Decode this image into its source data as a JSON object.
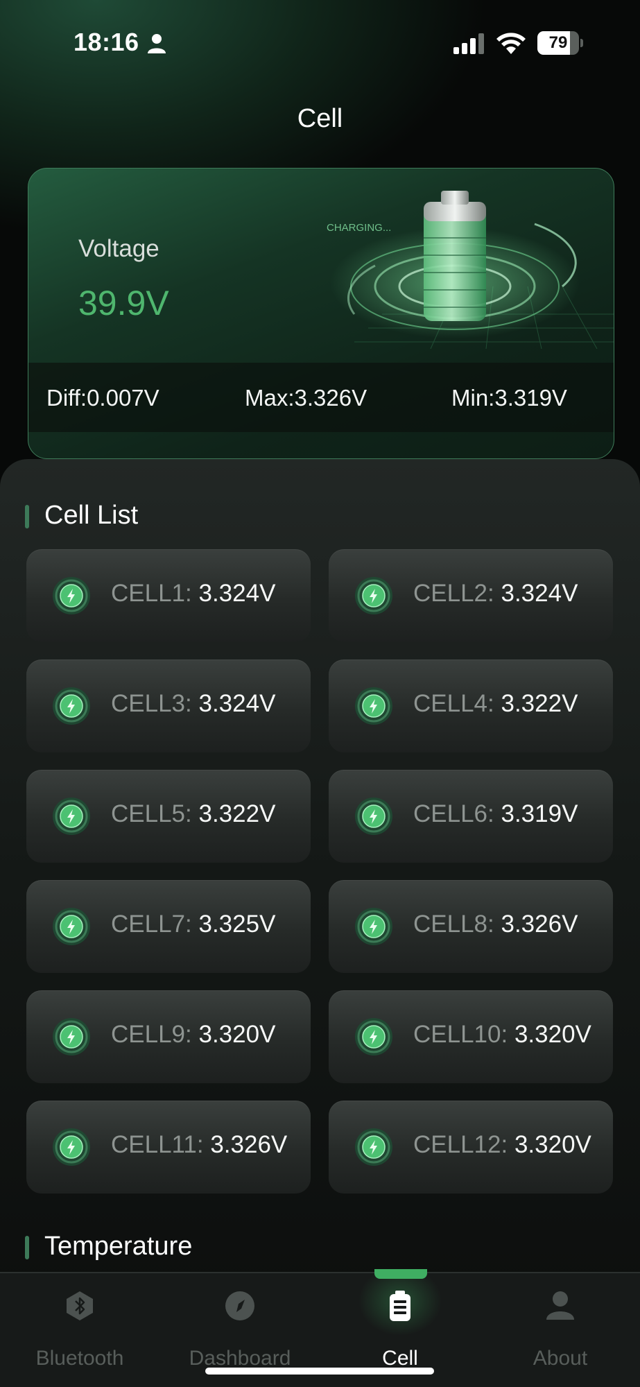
{
  "status_bar": {
    "time": "18:16",
    "battery_level": "79",
    "battery_fraction": 0.79,
    "icons": [
      "person-icon",
      "signal-icon",
      "wifi-icon",
      "battery-icon"
    ]
  },
  "header": {
    "title": "Cell"
  },
  "voltage_card": {
    "label": "Voltage",
    "value": "39.9V",
    "graphic_text": "CHARGING...",
    "diff": "Diff:0.007V",
    "max": "Max:3.326V",
    "min": "Min:3.319V"
  },
  "cell_list": {
    "title": "Cell List",
    "cells": [
      {
        "name": "CELL1:",
        "value": "3.324V"
      },
      {
        "name": "CELL2:",
        "value": "3.324V"
      },
      {
        "name": "CELL3:",
        "value": "3.324V"
      },
      {
        "name": "CELL4:",
        "value": "3.322V"
      },
      {
        "name": "CELL5:",
        "value": "3.322V"
      },
      {
        "name": "CELL6:",
        "value": "3.319V"
      },
      {
        "name": "CELL7:",
        "value": "3.325V"
      },
      {
        "name": "CELL8:",
        "value": "3.326V"
      },
      {
        "name": "CELL9:",
        "value": "3.320V"
      },
      {
        "name": "CELL10:",
        "value": "3.320V"
      },
      {
        "name": "CELL11:",
        "value": "3.326V"
      },
      {
        "name": "CELL12:",
        "value": "3.320V"
      }
    ]
  },
  "temperature": {
    "title": "Temperature"
  },
  "tabs": [
    {
      "label": "Bluetooth",
      "icon": "bluetooth-icon",
      "active": false
    },
    {
      "label": "Dashboard",
      "icon": "compass-icon",
      "active": false
    },
    {
      "label": "Cell",
      "icon": "battery-tab-icon",
      "active": true
    },
    {
      "label": "About",
      "icon": "user-icon",
      "active": false
    }
  ],
  "colors": {
    "accent": "#3fae62",
    "voltage_value": "#4fb66e",
    "background": "#0b0d0c",
    "cell_label": "#8e9491"
  }
}
